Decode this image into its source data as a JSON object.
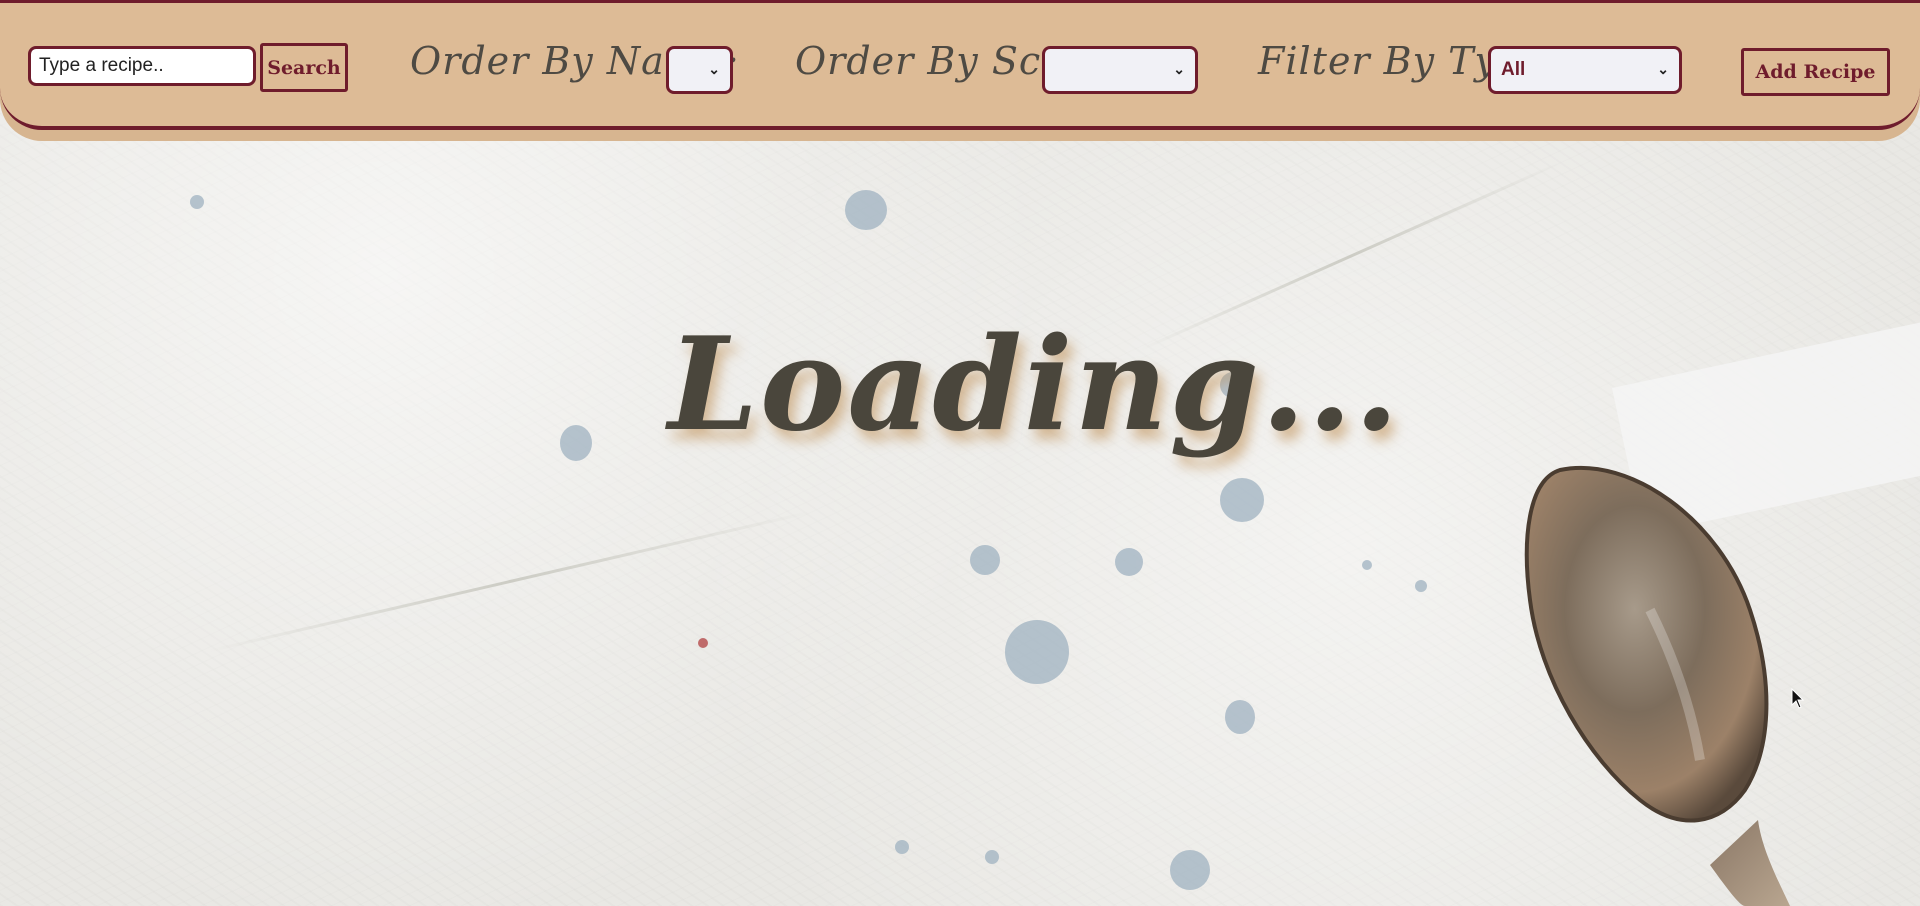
{
  "header": {
    "search": {
      "placeholder": "Type a recipe..",
      "value": "",
      "button_label": "Search"
    },
    "order_by_name": {
      "label": "Order By Name:",
      "selected": ""
    },
    "order_by_score": {
      "label": "Order By Score:",
      "selected": ""
    },
    "filter_by_type": {
      "label": "Filter By Type:",
      "selected": "All"
    },
    "add_recipe_label": "Add Recipe"
  },
  "main": {
    "loading_text": "Loading..."
  },
  "colors": {
    "header_bg": "#ddbb96",
    "accent": "#6f1c2c",
    "text_dark": "#4e4a43"
  }
}
